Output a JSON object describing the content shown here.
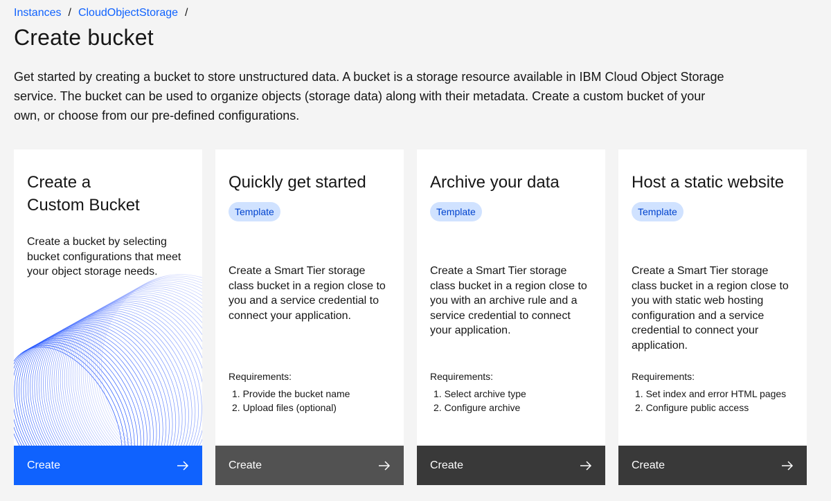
{
  "breadcrumb": {
    "items": [
      "Instances",
      "CloudObjectStorage"
    ],
    "separator": "/"
  },
  "page_title": "Create bucket",
  "intro": "Get started by creating a bucket to store unstructured data. A bucket is a storage resource available in IBM Cloud Object Storage service. The bucket can be used to organize objects (storage data) along with their metadata. Create a custom bucket of your own, or choose from our pre-defined configurations.",
  "cards": [
    {
      "title_line1": "Create a",
      "title_line2": "Custom Bucket",
      "description": "Create a bucket by selecting bucket configurations that meet your object storage needs.",
      "action_label": "Create",
      "action_icon": "arrow-right-icon"
    },
    {
      "title": "Quickly get started",
      "tag": "Template",
      "description": "Create a Smart Tier storage class bucket in a region close to you and a service credential to connect your application.",
      "requirements_label": "Requirements:",
      "requirements": [
        "1. Provide the bucket name",
        "2. Upload files (optional)"
      ],
      "action_label": "Create",
      "action_icon": "arrow-right-icon"
    },
    {
      "title": "Archive your data",
      "tag": "Template",
      "description": "Create a Smart Tier storage class bucket in a region close to you with an archive rule and a service credential to connect your application.",
      "requirements_label": "Requirements:",
      "requirements": [
        "1. Select archive type",
        "2. Configure archive"
      ],
      "action_label": "Create",
      "action_icon": "arrow-right-icon"
    },
    {
      "title": "Host a static website",
      "tag": "Template",
      "description": "Create a Smart Tier storage class bucket in a region close to you with static web hosting configuration and a service credential to connect your application.",
      "requirements_label": "Requirements:",
      "requirements": [
        "1. Set index and error HTML pages",
        "2. Configure public access"
      ],
      "action_label": "Create",
      "action_icon": "arrow-right-icon"
    }
  ],
  "colors": {
    "link": "#0f62fe",
    "primary_button": "#0f62fe",
    "secondary_button": "#525252",
    "dark_button": "#393939",
    "tag_background": "#d0e2ff",
    "tag_text": "#0043ce",
    "background": "#f4f4f4",
    "card_background": "#ffffff"
  }
}
